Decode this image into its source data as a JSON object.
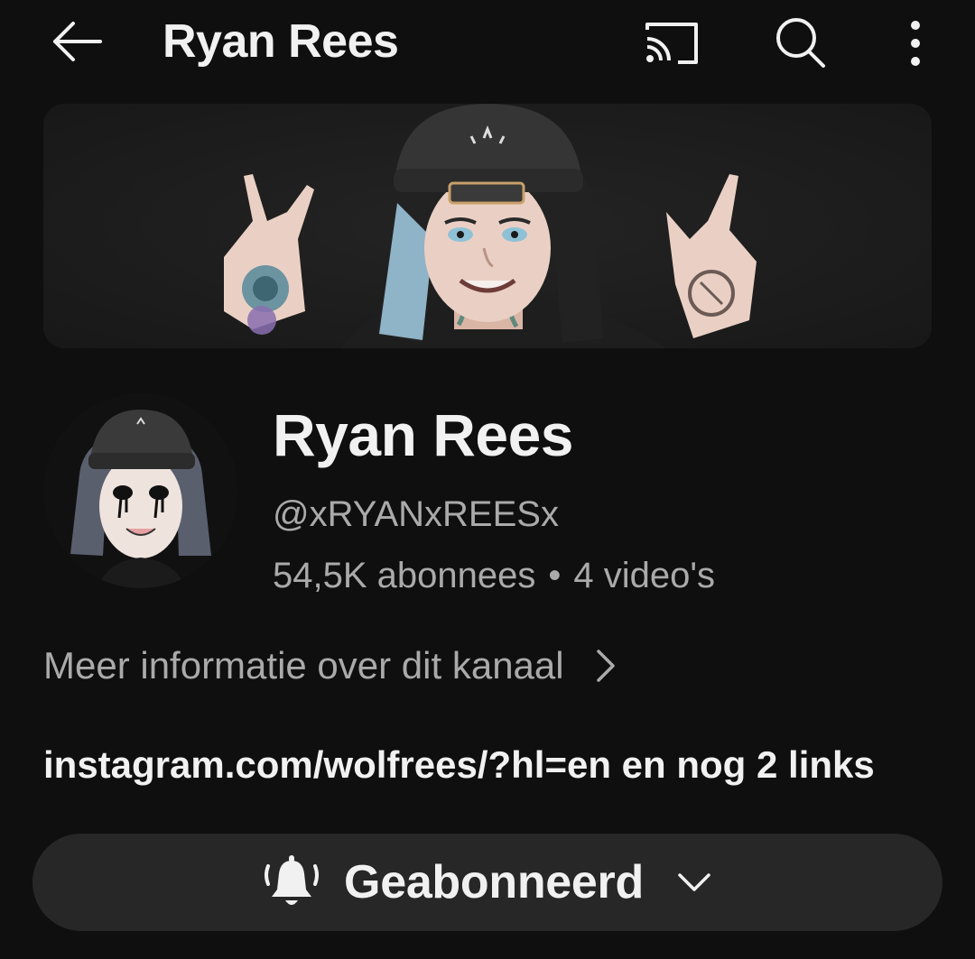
{
  "header": {
    "title": "Ryan Rees",
    "icons": [
      "back-arrow-icon",
      "cast-icon",
      "search-icon",
      "more-vert-icon"
    ]
  },
  "channel": {
    "name": "Ryan Rees",
    "handle": "@xRYANxREESx",
    "subscribers": "54,5K abonnees",
    "separator": "•",
    "videos": "4 video's",
    "more_info": "Meer informatie over dit kanaal",
    "links": "instagram.com/wolfrees/?hl=en en nog 2 links"
  },
  "subscribe": {
    "label": "Geabonneerd",
    "icon": "bell-ringing-icon"
  },
  "colors": {
    "background": "#0f0f0f",
    "primary_text": "#f1f1f1",
    "secondary_text": "#aaaaaa",
    "button_bg": "#272727"
  }
}
